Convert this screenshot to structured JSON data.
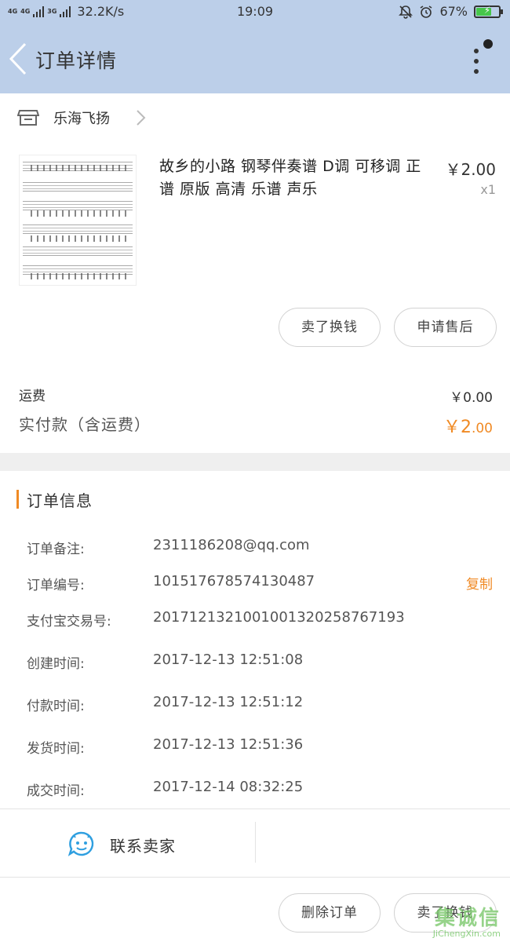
{
  "status_bar": {
    "net1": "4G",
    "net2": "4G",
    "net3": "3G",
    "speed": "32.2K/s",
    "time": "19:09",
    "battery": "67%",
    "battery_level": 0.67
  },
  "header": {
    "title": "订单详情",
    "icons": [
      "back-arrow-icon",
      "more-vertical-icon"
    ]
  },
  "shop": {
    "name": "乐海飞扬",
    "icon": "shop-icon"
  },
  "product": {
    "title": "故乡的小路 钢琴伴奏谱 D调 可移调 正谱 原版 高清 乐谱 声乐",
    "price": "￥2.00",
    "quantity": "x1",
    "thumbnail": "sheet-music-image"
  },
  "actions": {
    "sell_label": "卖了换钱",
    "after_sale_label": "申请售后"
  },
  "fees": {
    "shipping_label": "运费",
    "shipping_value": "￥0.00",
    "paid_label": "实付款（含运费）",
    "paid_currency": "￥",
    "paid_int": "2",
    "paid_dec": ".00"
  },
  "order_info": {
    "title": "订单信息",
    "copy_label": "复制",
    "rows": [
      {
        "label": "订单备注:",
        "value": "2311186208@qq.com"
      },
      {
        "label": "订单编号:",
        "value": "101517678574130487"
      },
      {
        "label": "支付宝交易号:",
        "value": "2017121321001001320258767193"
      },
      {
        "label": "创建时间:",
        "value": "2017-12-13 12:51:08"
      },
      {
        "label": "付款时间:",
        "value": "2017-12-13 12:51:12"
      },
      {
        "label": "发货时间:",
        "value": "2017-12-13 12:51:36"
      },
      {
        "label": "成交时间:",
        "value": "2017-12-14 08:32:25"
      }
    ]
  },
  "contact": {
    "label": "联系卖家",
    "icon": "chat-bubble-icon"
  },
  "bottom": {
    "delete_label": "删除订单",
    "sell_label": "卖了换钱"
  },
  "watermark": {
    "text": "集诚信",
    "sub": "JiChengXin.com"
  },
  "colors": {
    "header_bg": "#bccfe9",
    "accent": "#f08a24"
  }
}
